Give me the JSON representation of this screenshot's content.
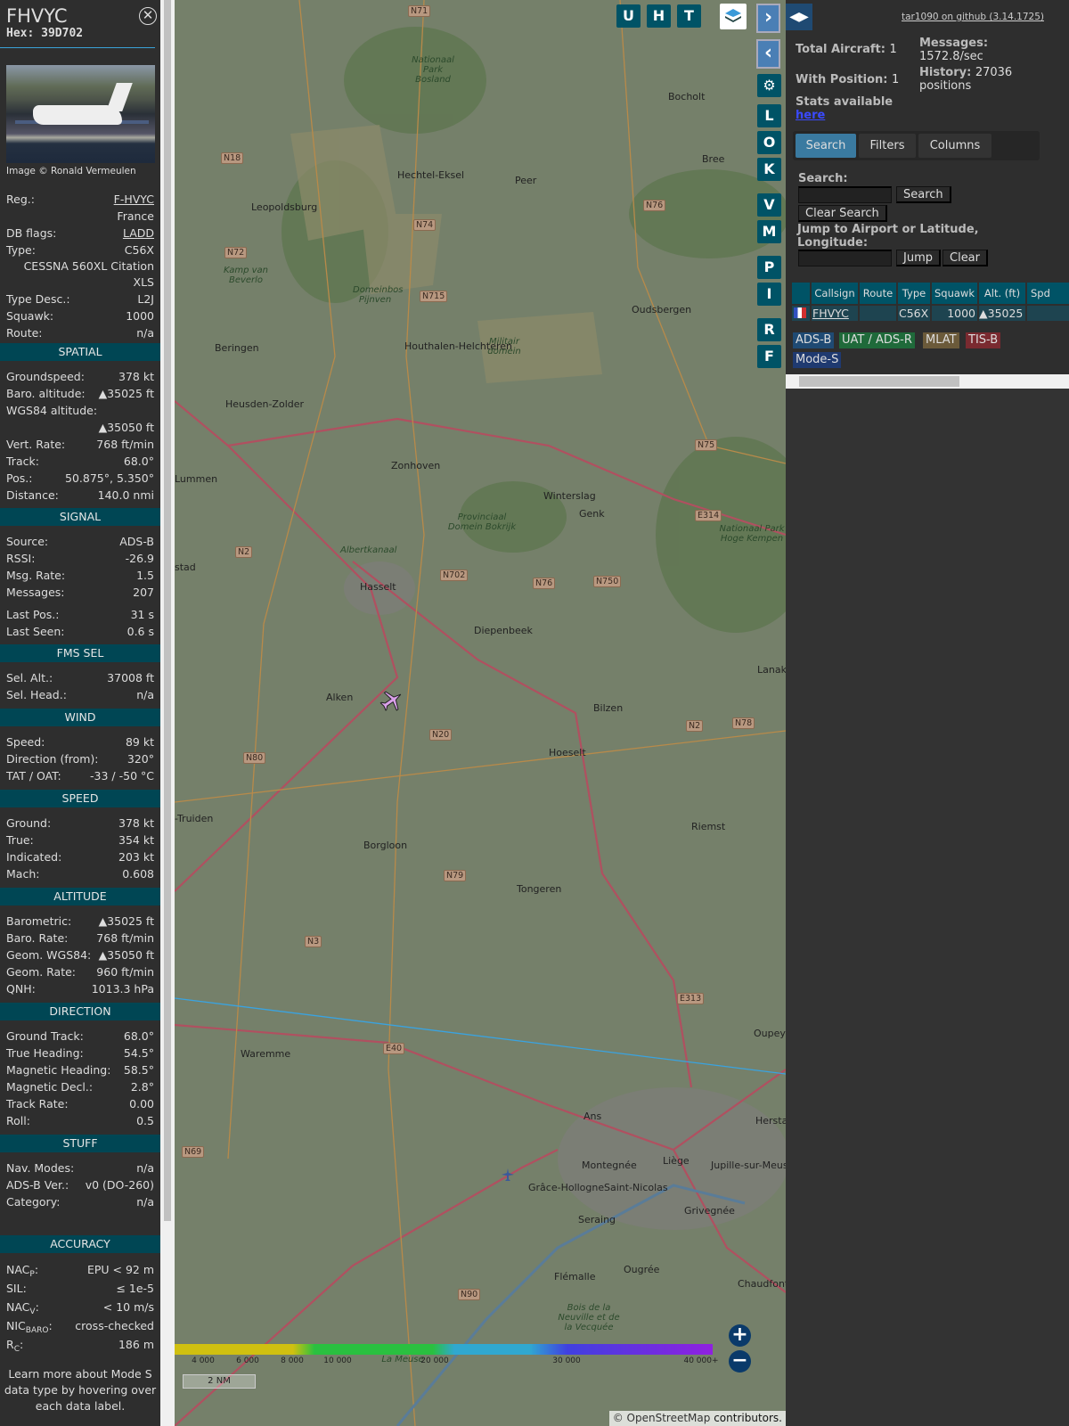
{
  "sidebar": {
    "callsign": "FHVYC",
    "hex": "Hex: 39D702",
    "close_icon": "circle-x",
    "image_credit": "Image © Ronald Vermeulen",
    "info": {
      "reg_label": "Reg.:",
      "reg": "F-HVYC",
      "country": "France",
      "dbflags_label": "DB flags:",
      "dbflags": "LADD",
      "type_label": "Type:",
      "type": "C56X",
      "type_name": "CESSNA 560XL Citation XLS",
      "typedesc_label": "Type Desc.:",
      "typedesc": "L2J",
      "squawk_label": "Squawk:",
      "squawk": "1000",
      "route_label": "Route:",
      "route": "n/a"
    },
    "spatial": {
      "header": "SPATIAL",
      "rows": [
        [
          "Groundspeed:",
          "378 kt"
        ],
        [
          "Baro. altitude:",
          "▲35025 ft"
        ]
      ],
      "wgs_label": "WGS84 altitude:",
      "wgs": "▲35050 ft",
      "rows2": [
        [
          "Vert. Rate:",
          "768 ft/min"
        ],
        [
          "Track:",
          "68.0°"
        ],
        [
          "Pos.:",
          "50.875°, 5.350°"
        ],
        [
          "Distance:",
          "140.0 nmi"
        ]
      ]
    },
    "signal": {
      "header": "SIGNAL",
      "rows": [
        [
          "Source:",
          "ADS-B"
        ],
        [
          "RSSI:",
          "-26.9"
        ],
        [
          "Msg. Rate:",
          "1.5"
        ],
        [
          "Messages:",
          "207"
        ]
      ],
      "rows2": [
        [
          "Last Pos.:",
          "31 s"
        ],
        [
          "Last Seen:",
          "0.6 s"
        ]
      ]
    },
    "fms": {
      "header": "FMS SEL",
      "rows": [
        [
          "Sel. Alt.:",
          "37008 ft"
        ],
        [
          "Sel. Head.:",
          "n/a"
        ]
      ]
    },
    "wind": {
      "header": "WIND",
      "rows": [
        [
          "Speed:",
          "89 kt"
        ],
        [
          "Direction (from):",
          "320°"
        ],
        [
          "TAT / OAT:",
          "-33 / -50 °C"
        ]
      ]
    },
    "speed": {
      "header": "SPEED",
      "rows": [
        [
          "Ground:",
          "378 kt"
        ],
        [
          "True:",
          "354 kt"
        ],
        [
          "Indicated:",
          "203 kt"
        ],
        [
          "Mach:",
          "0.608"
        ]
      ]
    },
    "altitude": {
      "header": "ALTITUDE",
      "rows": [
        [
          "Barometric:",
          "▲35025 ft"
        ],
        [
          "Baro. Rate:",
          "768 ft/min"
        ],
        [
          "Geom. WGS84:",
          "▲35050 ft"
        ],
        [
          "Geom. Rate:",
          "960 ft/min"
        ],
        [
          "QNH:",
          "1013.3 hPa"
        ]
      ]
    },
    "direction": {
      "header": "DIRECTION",
      "rows": [
        [
          "Ground Track:",
          "68.0°"
        ],
        [
          "True Heading:",
          "54.5°"
        ],
        [
          "Magnetic Heading:",
          "58.5°"
        ],
        [
          "Magnetic Decl.:",
          "2.8°"
        ],
        [
          "Track Rate:",
          "0.00"
        ],
        [
          "Roll:",
          "0.5"
        ]
      ]
    },
    "stuff": {
      "header": "STUFF",
      "rows": [
        [
          "Nav. Modes:",
          "n/a"
        ],
        [
          "ADS-B Ver.:",
          "v0 (DO-260)"
        ],
        [
          "Category:",
          "n/a"
        ]
      ]
    },
    "accuracy": {
      "header": "ACCURACY",
      "nacp": "NAC",
      "nacp_sub": "P",
      "nacp_v": "EPU < 92 m",
      "sil": "SIL:",
      "sil_v": "≤ 1e-5",
      "nacv": "NAC",
      "nacv_sub": "V",
      "nacv_v": "< 10 m/s",
      "nic": "NIC",
      "nic_sub": "BARO",
      "nic_v": "cross-checked",
      "rc": "R",
      "rc_sub": "C",
      "rc_v": "186 m"
    },
    "learn_more": "Learn more about Mode S data type by hovering over each data label."
  },
  "map": {
    "top_buttons": [
      "U",
      "H",
      "T"
    ],
    "side_buttons": [
      "L",
      "O",
      "K",
      "V",
      "M",
      "P",
      "I",
      "R",
      "F"
    ],
    "places": [
      "Peer",
      "Hechtel-Eksel",
      "Leopoldsburg",
      "Bocholt",
      "Bree",
      "Beringen",
      "Houthalen-Helchteren",
      "Oudsbergen",
      "Heusden-Zolder",
      "Zonhoven",
      "Winterslag",
      "Genk",
      "Hasselt",
      "Diepenbeek",
      "Alken",
      "Bilzen",
      "Hoeselt",
      "Riemst",
      "Borgloon",
      "Tongeren",
      "Waremme",
      "Ans",
      "Liège",
      "Herstal",
      "Montegnée",
      "Saint-Nicolas",
      "Grâce-Hollogne",
      "Seraing",
      "Grivegnée",
      "Flémalle",
      "Ougrée",
      "Chaudfontaine",
      "Lummen",
      "Jupille-sur-Meuse",
      "Oupeye",
      "Lanaken",
      "-Truiden",
      "stad"
    ],
    "nature": [
      "Nationaal Park Bosland",
      "Kamp van Beverlo",
      "Militair domein",
      "Provinciaal Domein Bokrijk",
      "Nationaal Park Hoge Kempen",
      "Domeinbos Pijnven",
      "Bois de la Neuville et de la Vecquée",
      "Albertkanaal",
      "La Meuse"
    ],
    "roads": [
      "N71",
      "N18",
      "N74",
      "N72",
      "N715",
      "N76",
      "N75",
      "E314",
      "N2",
      "N702",
      "N76",
      "N750",
      "N20",
      "N2",
      "N78",
      "N80",
      "N79",
      "N3",
      "E313",
      "E40",
      "N69",
      "N90"
    ],
    "altitude_scale": [
      "4 000",
      "6 000",
      "8 000",
      "10 000",
      "20 000",
      "30 000",
      "40 000+"
    ],
    "scale_bar": "2 NM",
    "attribution_prefix": "© ",
    "attribution_link": "OpenStreetMap",
    "attribution_suffix": " contributors.",
    "zoom_in": "+",
    "zoom_out": "−"
  },
  "panel": {
    "github": "tar1090 on github (3.14.1725)",
    "total_label": "Total Aircraft:",
    "total": "1",
    "withpos_label": "With Position:",
    "withpos": "1",
    "messages_label": "Messages:",
    "messages": "1572.8/sec",
    "history_label": "History:",
    "history": "27036 positions",
    "stats_label": "Stats available",
    "stats_link": "here",
    "tabs": [
      "Search",
      "Filters",
      "Columns"
    ],
    "search_label": "Search:",
    "search_btn": "Search",
    "clear_search_btn": "Clear Search",
    "jump_label": "Jump to Airport or Latitude, Longitude:",
    "jump_btn": "Jump",
    "clear_btn": "Clear",
    "columns": [
      "Callsign",
      "Route",
      "Type",
      "Squawk",
      "Alt. (ft)",
      "Spd"
    ],
    "row": {
      "callsign": "FHVYC",
      "route": "",
      "type": "C56X",
      "squawk": "1000",
      "alt": "▲35025"
    },
    "legend": [
      {
        "label": "ADS-B",
        "color": "#1f4a73"
      },
      {
        "label": "UAT / ADS-R",
        "color": "#1f6a3a"
      },
      {
        "label": "MLAT",
        "color": "#6b5a3a"
      },
      {
        "label": "TIS-B",
        "color": "#7a2a30"
      },
      {
        "label": "Mode-S",
        "color": "#1f3a70"
      }
    ]
  }
}
